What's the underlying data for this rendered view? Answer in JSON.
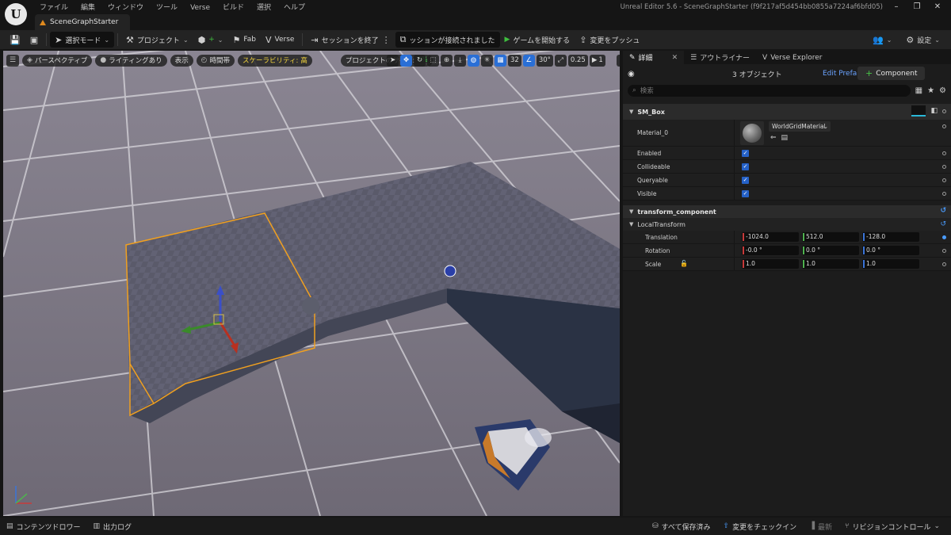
{
  "window": {
    "title": "Unreal Editor 5.6 - SceneGraphStarter (f9f217af5d454bb0855a7224af6bfd05)",
    "document_tab": "SceneGraphStarter"
  },
  "menu": [
    "ファイル",
    "編集",
    "ウィンドウ",
    "ツール",
    "Verse",
    "ビルド",
    "選択",
    "ヘルプ"
  ],
  "toolbar": {
    "select_mode": "選択モード",
    "project": "プロジェクト",
    "fab": "Fab",
    "verse": "Verse",
    "end_session": "セッションを終了",
    "session_status": "ッションが接続されました",
    "start_game": "ゲームを開始する",
    "push_changes": "変更をプッシュ",
    "settings": "設定"
  },
  "viewport": {
    "perspective": "パースペクティブ",
    "lighting": "ライティングあり",
    "show": "表示",
    "time_of_day": "時間帯",
    "scalability_label": "スケーラビリティ:",
    "scalability_value": "高",
    "project_size_label": "プロジェクトのサイズ:",
    "project_size_value": "0%",
    "grid_snap": "32",
    "rotation_snap": "30°",
    "scale_snap": "0.25",
    "camera_speed": "1"
  },
  "details": {
    "tabs": [
      "詳細",
      "アウトライナー",
      "Verse Explorer"
    ],
    "object_count": "3 オブジェクト",
    "edit_prefab": "Edit Prefab",
    "add_component": "Component",
    "search_placeholder": "検索",
    "sm_box": {
      "title": "SM_Box",
      "material_label": "Material_0",
      "material_value": "WorldGridMaterial",
      "rows": [
        {
          "label": "Enabled",
          "checked": true
        },
        {
          "label": "Collideable",
          "checked": true
        },
        {
          "label": "Queryable",
          "checked": true
        },
        {
          "label": "Visible",
          "checked": true
        }
      ]
    },
    "transform": {
      "title": "transform_component",
      "local": "LocalTransform",
      "translation_label": "Translation",
      "translation": [
        "-1024.0",
        "512.0",
        "-128.0"
      ],
      "rotation_label": "Rotation",
      "rotation": [
        "-0.0 °",
        "0.0 °",
        "0.0 °"
      ],
      "scale_label": "Scale",
      "scale": [
        "1.0",
        "1.0",
        "1.0"
      ]
    }
  },
  "statusbar": {
    "content_drawer": "コンテンツドロワー",
    "output_log": "出力ログ",
    "save_all": "すべて保存済み",
    "check_in": "変更をチェックイン",
    "latest": "最新",
    "revision_control": "リビジョンコントロール"
  },
  "colors": {
    "accent_blue": "#2a6fd6",
    "selection_orange": "#f0a020",
    "play_green": "#3fbf3f",
    "scalability_yellow": "#f0d23c"
  }
}
